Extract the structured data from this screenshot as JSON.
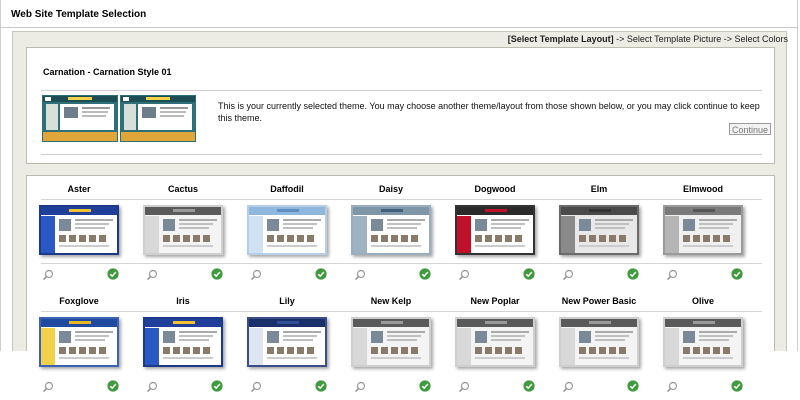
{
  "page": {
    "title": "Web Site Template Selection"
  },
  "steps": {
    "current": "[Select Template Layout]",
    "rest": " -> Select Template Picture -> Select Colors"
  },
  "selected": {
    "name": "Carnation - Carnation Style 01",
    "description": "This is your currently selected theme. You may choose another theme/layout from those shown below, or you may click continue to keep this theme.",
    "continue_label": "Continue"
  },
  "templates_row1": [
    {
      "name": "Aster",
      "style": "blue"
    },
    {
      "name": "Cactus",
      "style": "gray"
    },
    {
      "name": "Daffodil",
      "style": "lightblue"
    },
    {
      "name": "Daisy",
      "style": "steel"
    },
    {
      "name": "Dogwood",
      "style": "red"
    },
    {
      "name": "Elm",
      "style": "darkgray"
    },
    {
      "name": "Elmwood",
      "style": "silver"
    }
  ],
  "templates_row2": [
    {
      "name": "Foxglove",
      "style": "yellow"
    },
    {
      "name": "Iris",
      "style": "blue"
    },
    {
      "name": "Lily",
      "style": "navy"
    },
    {
      "name": "New Kelp",
      "style": "gray"
    },
    {
      "name": "New Poplar",
      "style": "gray"
    },
    {
      "name": "New Power Basic",
      "style": "gray"
    },
    {
      "name": "Olive",
      "style": "gray"
    }
  ],
  "icons": {
    "preview": "magnifier-icon",
    "select": "checkmark-icon"
  },
  "colors": {
    "accent_green": "#3f9a3c",
    "panel_bg": "#ecebe4",
    "border": "#bdbab0"
  }
}
